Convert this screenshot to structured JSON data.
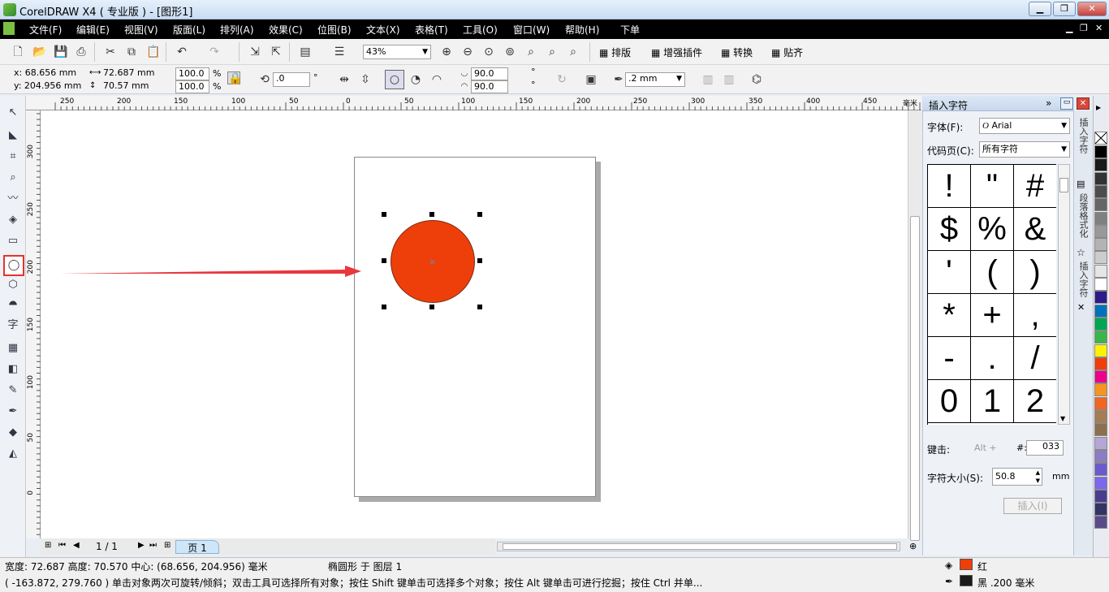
{
  "window": {
    "title": "CorelDRAW X4 ( 专业版 ) - [图形1]"
  },
  "menu": [
    "文件(F)",
    "编辑(E)",
    "视图(V)",
    "版面(L)",
    "排列(A)",
    "效果(C)",
    "位图(B)",
    "文本(X)",
    "表格(T)",
    "工具(O)",
    "窗口(W)",
    "帮助(H)",
    "下单"
  ],
  "toolbar": {
    "zoom": "43%",
    "buttons": [
      "排版",
      "增强插件",
      "转换",
      "贴齐"
    ]
  },
  "property_bar": {
    "x": "x: 68.656 mm",
    "y": "y: 204.956 mm",
    "width": "72.687 mm",
    "height": "70.57 mm",
    "scale_x": "100.0",
    "scale_y": "100.0",
    "percent": "%",
    "rotation": ".0",
    "degree": "°",
    "angle_start": "90.0",
    "angle_end": "90.0",
    "outline": ".2 mm"
  },
  "ruler_top": [
    "250",
    "200",
    "150",
    "100",
    "50",
    "0",
    "50",
    "100",
    "150",
    "200",
    "250",
    "300",
    "350",
    "400",
    "450"
  ],
  "ruler_top_unit": "毫米",
  "ruler_left": [
    "300",
    "250",
    "200",
    "150",
    "100",
    "50",
    "0"
  ],
  "page_nav": {
    "current": "1 / 1",
    "tab": "页 1"
  },
  "docker": {
    "title": "插入字符",
    "font_label": "字体(F):",
    "font_value": "Arial",
    "codepage_label": "代码页(C):",
    "codepage_value": "所有字符",
    "glyphs": [
      "!",
      "\"",
      "#",
      "$",
      "%",
      "&",
      "'",
      "(",
      ")",
      "*",
      "+",
      ",",
      "-",
      ".",
      "/",
      "0",
      "1",
      "2"
    ],
    "keystroke_label": "键击:",
    "keystroke_value": "Alt +",
    "hash_label": "#:",
    "hash_value": "033",
    "size_label": "字符大小(S):",
    "size_value": "50.8",
    "size_unit": "mm",
    "insert_button": "插入(I)"
  },
  "vertical_tabs": [
    "插入字符",
    "段落格式化",
    "插入字符"
  ],
  "status": {
    "line1": "宽度: 72.687  高度: 70.570  中心: (68.656, 204.956)  毫米",
    "object_info": "椭圆形 于 图层 1",
    "line2": "( -163.872, 279.760 )   单击对象两次可旋转/倾斜；双击工具可选择所有对象；按住 Shift 键单击可选择多个对象；按住 Alt 键单击可进行挖掘；按住 Ctrl 并单...",
    "fill_name": "红",
    "outline_name": "黑 .200 毫米"
  },
  "colors": {
    "fill": "#ee3f0b",
    "outline": "#1a1a1a",
    "arrow": "#e8383d"
  },
  "palette": [
    "#000000",
    "#1a1a1a",
    "#333333",
    "#4d4d4d",
    "#666666",
    "#808080",
    "#999999",
    "#b3b3b3",
    "#cccccc",
    "#e6e6e6",
    "#ffffff",
    "#2e1a8a",
    "#0072bc",
    "#00a651",
    "#39b54a",
    "#fff200",
    "#ee3f0b",
    "#ec008c",
    "#f7941d",
    "#f26522",
    "#a67c52",
    "#8b6f4e",
    "#b4a7d6",
    "#8e7cc3",
    "#6a5acd",
    "#7b68ee",
    "#4b3b8f",
    "#333366",
    "#5b4a8a"
  ]
}
